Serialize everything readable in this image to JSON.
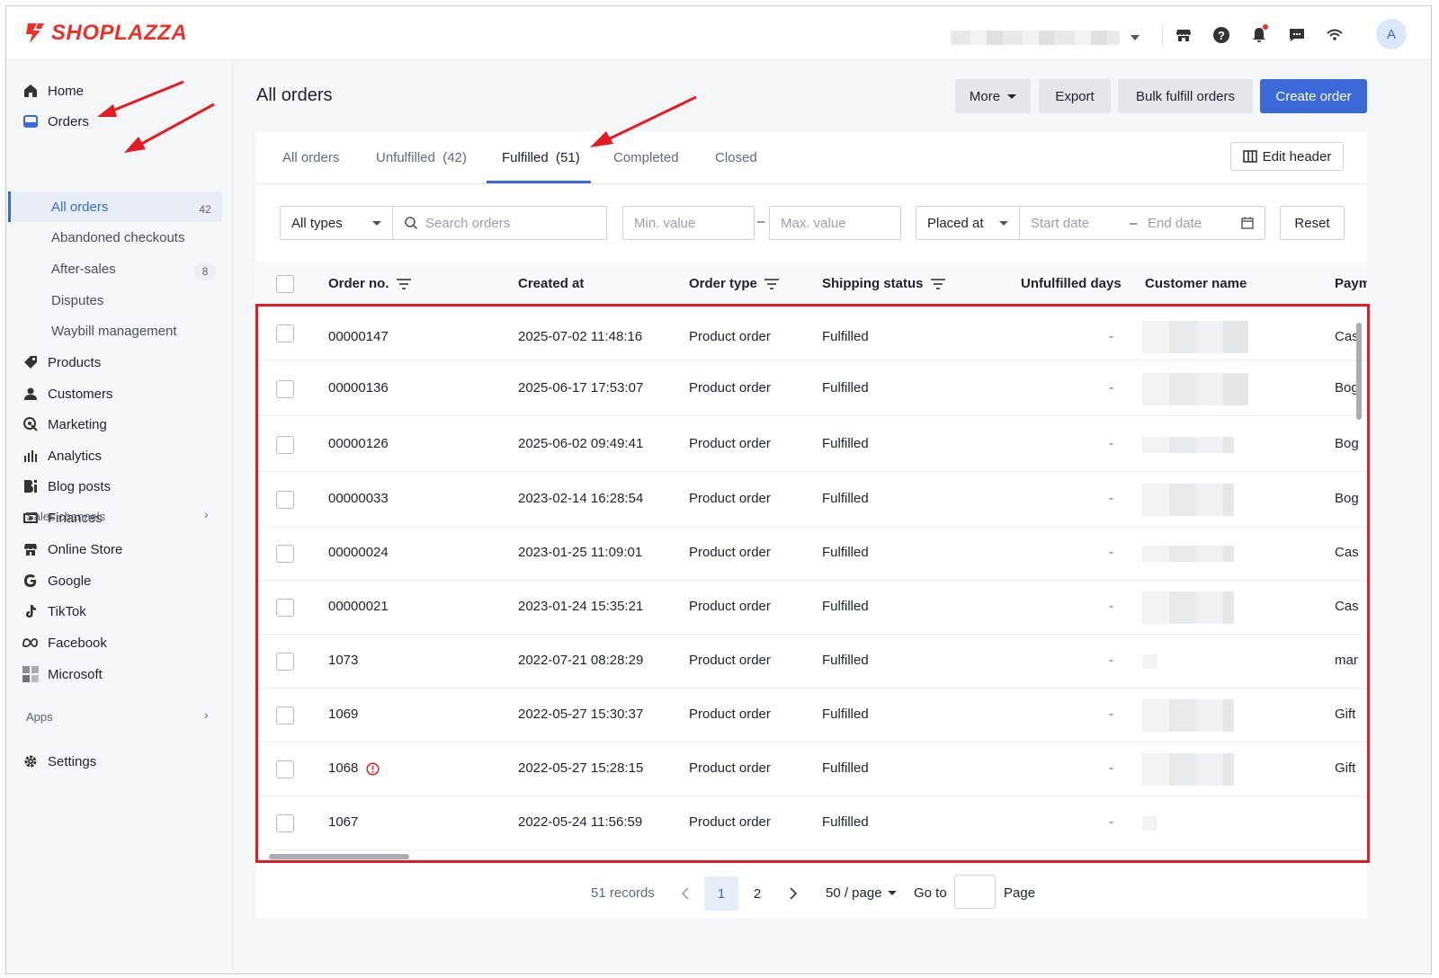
{
  "brand": {
    "name": "SHOPLAZZA",
    "color": "#e8332a"
  },
  "topbar": {
    "icons": [
      "store-icon",
      "help-icon",
      "bell-icon",
      "chat-icon",
      "wifi-icon"
    ],
    "avatar_letter": "A"
  },
  "sidebar": {
    "items": [
      {
        "label": "Home",
        "icon": "home-icon"
      },
      {
        "label": "Orders",
        "icon": "orders-icon"
      },
      {
        "label": "Products",
        "icon": "tag-icon"
      },
      {
        "label": "Customers",
        "icon": "person-icon"
      },
      {
        "label": "Marketing",
        "icon": "marketing-icon"
      },
      {
        "label": "Analytics",
        "icon": "bar-chart-icon"
      },
      {
        "label": "Blog posts",
        "icon": "blog-icon"
      },
      {
        "label": "Finances",
        "icon": "finance-icon"
      }
    ],
    "orders_sub": [
      {
        "label": "All orders",
        "count": "42"
      },
      {
        "label": "Abandoned checkouts"
      },
      {
        "label": "After-sales",
        "count": "8"
      },
      {
        "label": "Disputes"
      },
      {
        "label": "Waybill management"
      }
    ],
    "sales_channels_label": "Sales channels",
    "channels": [
      {
        "label": "Online Store",
        "icon": "store-icon"
      },
      {
        "label": "Google",
        "icon": "google-icon"
      },
      {
        "label": "TikTok",
        "icon": "tiktok-icon"
      },
      {
        "label": "Facebook",
        "icon": "meta-icon"
      },
      {
        "label": "Microsoft",
        "icon": "microsoft-icon"
      }
    ],
    "apps_label": "Apps",
    "settings_label": "Settings"
  },
  "header": {
    "title": "All orders",
    "more_label": "More",
    "export_label": "Export",
    "bulk_label": "Bulk fulfill orders",
    "create_label": "Create order",
    "accent": "#3b6ad8"
  },
  "tabs": [
    {
      "label": "All orders"
    },
    {
      "label": "Unfulfilled  (42)"
    },
    {
      "label": "Fulfilled  (51)",
      "active": true
    },
    {
      "label": "Completed"
    },
    {
      "label": "Closed"
    }
  ],
  "edit_header_label": "Edit header",
  "filters": {
    "type_value": "All types",
    "search_placeholder": "Search orders",
    "min_placeholder": "Min. value",
    "max_placeholder": "Max. value",
    "date_type": "Placed at",
    "start_placeholder": "Start date",
    "end_placeholder": "End date",
    "reset_label": "Reset",
    "dash": "–"
  },
  "table": {
    "columns": [
      "Order no.",
      "Created at",
      "Order type",
      "Shipping status",
      "Unfulfilled days",
      "Customer name",
      "Paym"
    ],
    "rows": [
      {
        "no": "00000147",
        "created": "2025-07-02 11:48:16",
        "type": "Product order",
        "status": "Fulfilled",
        "days": "-",
        "pay": "Cash"
      },
      {
        "no": "00000136",
        "created": "2025-06-17 17:53:07",
        "type": "Product order",
        "status": "Fulfilled",
        "days": "-",
        "pay": "Bogus"
      },
      {
        "no": "00000126",
        "created": "2025-06-02 09:49:41",
        "type": "Product order",
        "status": "Fulfilled",
        "days": "-",
        "pay": "Bogus"
      },
      {
        "no": "00000033",
        "created": "2023-02-14 16:28:54",
        "type": "Product order",
        "status": "Fulfilled",
        "days": "-",
        "pay": "Bogus"
      },
      {
        "no": "00000024",
        "created": "2023-01-25 11:09:01",
        "type": "Product order",
        "status": "Fulfilled",
        "days": "-",
        "pay": "Cash"
      },
      {
        "no": "00000021",
        "created": "2023-01-24 15:35:21",
        "type": "Product order",
        "status": "Fulfilled",
        "days": "-",
        "pay": "Cash"
      },
      {
        "no": "1073",
        "created": "2022-07-21 08:28:29",
        "type": "Product order",
        "status": "Fulfilled",
        "days": "-",
        "pay": "manual"
      },
      {
        "no": "1069",
        "created": "2022-05-27 15:30:37",
        "type": "Product order",
        "status": "Fulfilled",
        "days": "-",
        "pay": "Gift"
      },
      {
        "no": "1068",
        "created": "2022-05-27 15:28:15",
        "type": "Product order",
        "status": "Fulfilled",
        "days": "-",
        "pay": "Gift",
        "warning": true
      },
      {
        "no": "1067",
        "created": "2022-05-24 11:56:59",
        "type": "Product order",
        "status": "Fulfilled",
        "days": "-",
        "pay": ""
      }
    ]
  },
  "pagination": {
    "records": "51 records",
    "pages": [
      "1",
      "2"
    ],
    "current": "1",
    "page_size": "50 / page",
    "goto_label": "Go to",
    "page_label": "Page"
  },
  "annotation_color": "#e41b23"
}
